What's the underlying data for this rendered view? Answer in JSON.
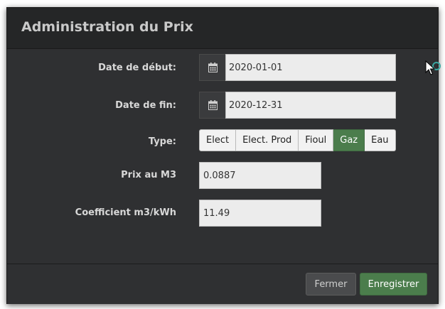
{
  "modal": {
    "title": "Administration du Prix"
  },
  "form": {
    "start_date": {
      "label": "Date de début:",
      "value": "2020-01-01",
      "icon": "calendar-icon"
    },
    "end_date": {
      "label": "Date de fin:",
      "value": "2020-12-31",
      "icon": "calendar-icon"
    },
    "type": {
      "label": "Type:",
      "options": [
        "Elect",
        "Elect. Prod",
        "Fioul",
        "Gaz",
        "Eau"
      ],
      "selected": "Gaz"
    },
    "price": {
      "label": "Prix au M3",
      "value": "0.0887"
    },
    "coefficient": {
      "label": "Coefficient m3/kWh",
      "value": "11.49"
    }
  },
  "footer": {
    "close_label": "Fermer",
    "save_label": "Enregistrer"
  },
  "colors": {
    "modal_bg": "#2f3032",
    "header_bg": "#252627",
    "accent_green": "#4b7d4c",
    "input_bg": "#ececec"
  }
}
